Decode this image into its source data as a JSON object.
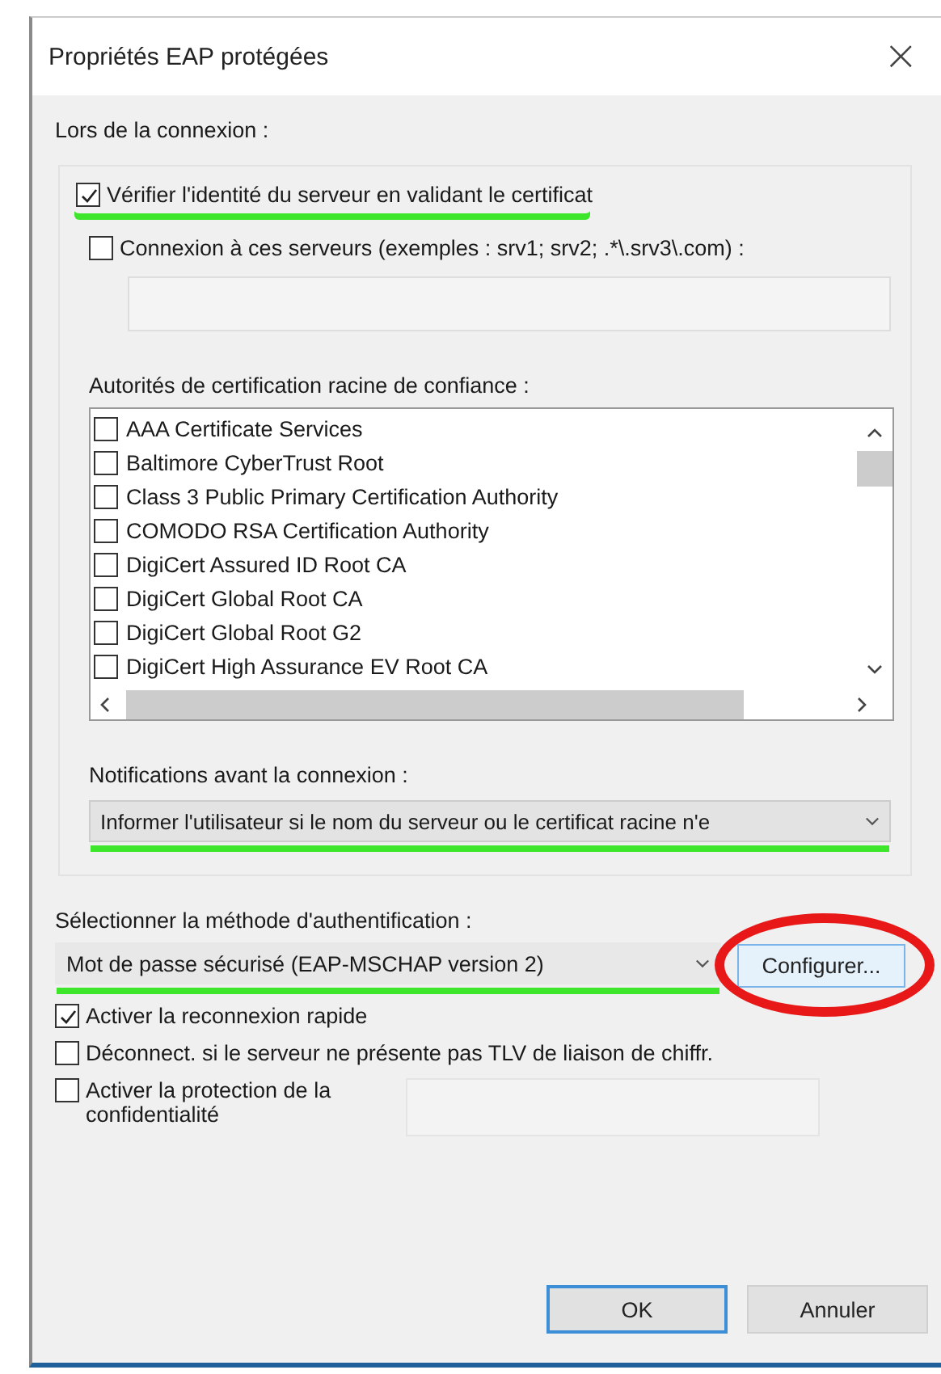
{
  "window": {
    "title": "Propriétés EAP protégées",
    "close": "×"
  },
  "connection": {
    "label": "Lors de la connexion :",
    "verify": {
      "label": "Vérifier l'identité du serveur en validant le certificat",
      "checked": true,
      "highlighted": true
    },
    "servers": {
      "label": "Connexion à ces serveurs (exemples : srv1; srv2; .*\\.srv3\\.com) :",
      "checked": false
    },
    "authorities_label": "Autorités de certification racine de confiance :",
    "authorities": [
      {
        "label": "AAA Certificate Services",
        "checked": false
      },
      {
        "label": "Baltimore CyberTrust Root",
        "checked": false
      },
      {
        "label": "Class 3 Public Primary Certification Authority",
        "checked": false
      },
      {
        "label": "COMODO RSA Certification Authority",
        "checked": false
      },
      {
        "label": "DigiCert Assured ID Root CA",
        "checked": false
      },
      {
        "label": "DigiCert Global Root CA",
        "checked": false
      },
      {
        "label": "DigiCert Global Root G2",
        "checked": false
      },
      {
        "label": "DigiCert High Assurance EV Root CA",
        "checked": false
      }
    ],
    "notifications_label": "Notifications avant la connexion :",
    "notifications": {
      "value": "Informer l'utilisateur si le nom du serveur ou le certificat racine n'e",
      "highlighted": true
    }
  },
  "method": {
    "label": "Sélectionner la méthode d'authentification :",
    "value": "Mot de passe sécurisé (EAP-MSCHAP version 2)",
    "highlighted": true,
    "configure": {
      "label": "Configurer...",
      "circled": true
    }
  },
  "options": [
    {
      "label": "Activer la reconnexion rapide",
      "checked": true
    },
    {
      "label": "Déconnect. si le serveur ne présente pas TLV de liaison de chiffr.",
      "checked": false
    },
    {
      "label": "Activer la protection de la confidentialité",
      "checked": false
    }
  ],
  "buttons": [
    {
      "label": "OK",
      "default": true
    },
    {
      "label": "Annuler",
      "default": false
    }
  ]
}
